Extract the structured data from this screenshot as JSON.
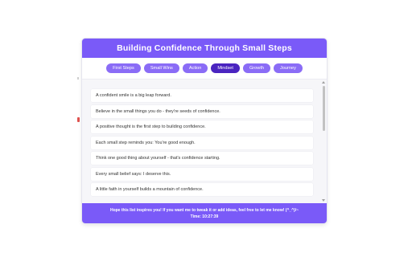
{
  "header": {
    "title": "Building Confidence Through Small Steps"
  },
  "tabs": [
    {
      "label": "First Steps",
      "active": false
    },
    {
      "label": "Small Wins",
      "active": false
    },
    {
      "label": "Action",
      "active": false
    },
    {
      "label": "Mindset",
      "active": true
    },
    {
      "label": "Growth",
      "active": false
    },
    {
      "label": "Journey",
      "active": false
    }
  ],
  "items": [
    "A confident smile is a big leap forward.",
    "Believe in the small things you do - they're seeds of confidence.",
    "A positive thought is the first step to building confidence.",
    "Each small step reminds you: You're good enough.",
    "Think one good thing about yourself - that's confidence starting.",
    "Every small belief says: I deserve this.",
    "A little faith in yourself builds a mountain of confidence."
  ],
  "footer": {
    "message": "Hope this list inspires you! If you want me to tweak it or add ideas, feel free to let me know! (^_^)/~",
    "time": "Time: 10:27:39"
  },
  "colors": {
    "accent": "#7a5af8",
    "tab": "#8a6cf6",
    "tab_active": "#4a24c0"
  }
}
